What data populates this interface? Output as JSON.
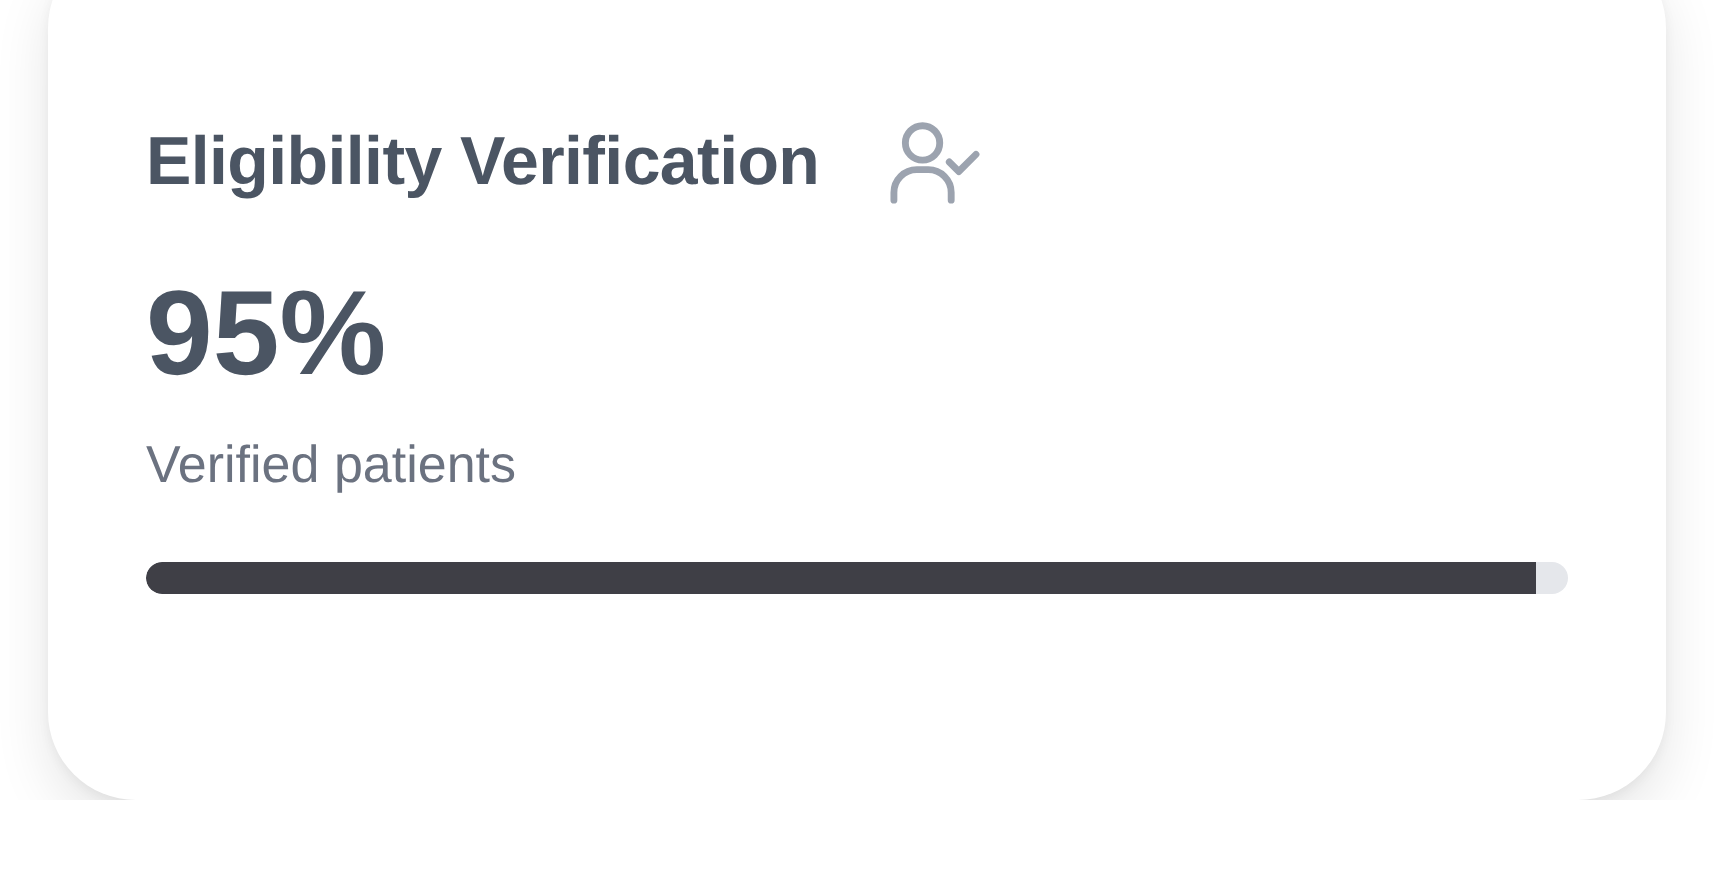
{
  "card": {
    "title": "Eligibility Verification",
    "value": "95%",
    "caption": "Verified patients",
    "progress": {
      "level": 0.977
    }
  }
}
